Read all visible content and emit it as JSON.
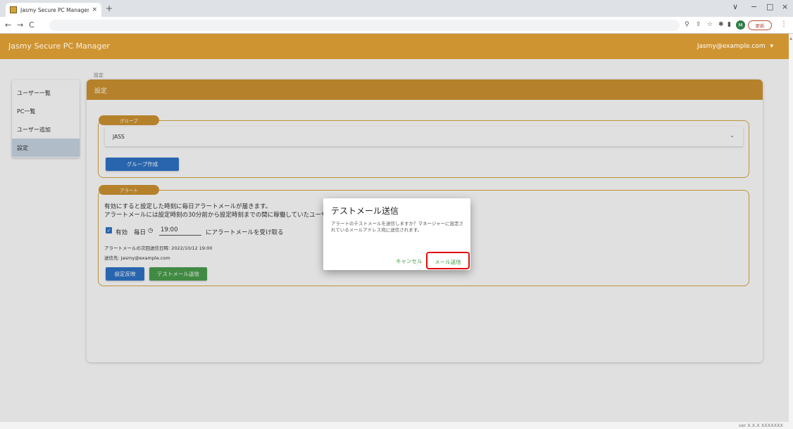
{
  "browser": {
    "tab_title": "Jasmy Secure PC Manager",
    "tab_close": "×",
    "new_tab": "+",
    "win_dropdown": "∨",
    "win_minimize": "−",
    "win_maximize": "□",
    "win_close": "×",
    "nav_back": "←",
    "nav_forward": "→",
    "nav_reload": "C",
    "avatar_letter": "M",
    "update_label": "更新"
  },
  "header": {
    "app_title": "Jasmy Secure PC Manager",
    "user_email": "Jasmy@example.com",
    "user_menu_caret": "▾"
  },
  "breadcrumb": "設定",
  "sidebar": {
    "items": [
      {
        "label": "ユーザー一覧"
      },
      {
        "label": "PC一覧"
      },
      {
        "label": "ユーザー追加"
      },
      {
        "label": "設定"
      }
    ],
    "active_index": 3
  },
  "settings": {
    "title": "設定",
    "group_section": {
      "legend": "グループ",
      "selected_group": "JASS",
      "create_button": "グループ作成"
    },
    "alert_section": {
      "legend": "アラート",
      "description_line1": "有効にすると設定した時刻に毎日アラートメールが届きます。",
      "description_line2": "アラートメールには設定時刻の30分前から設定時刻までの間に稼働していたユーザ",
      "enabled_checked": true,
      "enabled_label": "有効",
      "daily_label": "毎日",
      "time_value": "19:00",
      "receive_label": "にアラートメールを受け取る",
      "next_send_label": "アラートメールの次回送信日時: 2022/10/12 19:00",
      "recipient_label": "送信先: Jasmy@example.com",
      "apply_button": "設定反映",
      "test_mail_button": "テストメール送信"
    }
  },
  "dialog": {
    "title": "テストメール送信",
    "body": "アラートのテストメールを送信しますか？マネージャーに設定されているメールアドレス宛に送信されます。",
    "cancel_label": "キャンセル",
    "send_label": "メール送信"
  },
  "footer": {
    "version": "ver X.X.X XXXXXXX"
  },
  "colors": {
    "brand": "#cf9432",
    "primary_button": "#2f73c7",
    "success_button": "#4a9e4d",
    "highlight": "#e00d0d"
  }
}
